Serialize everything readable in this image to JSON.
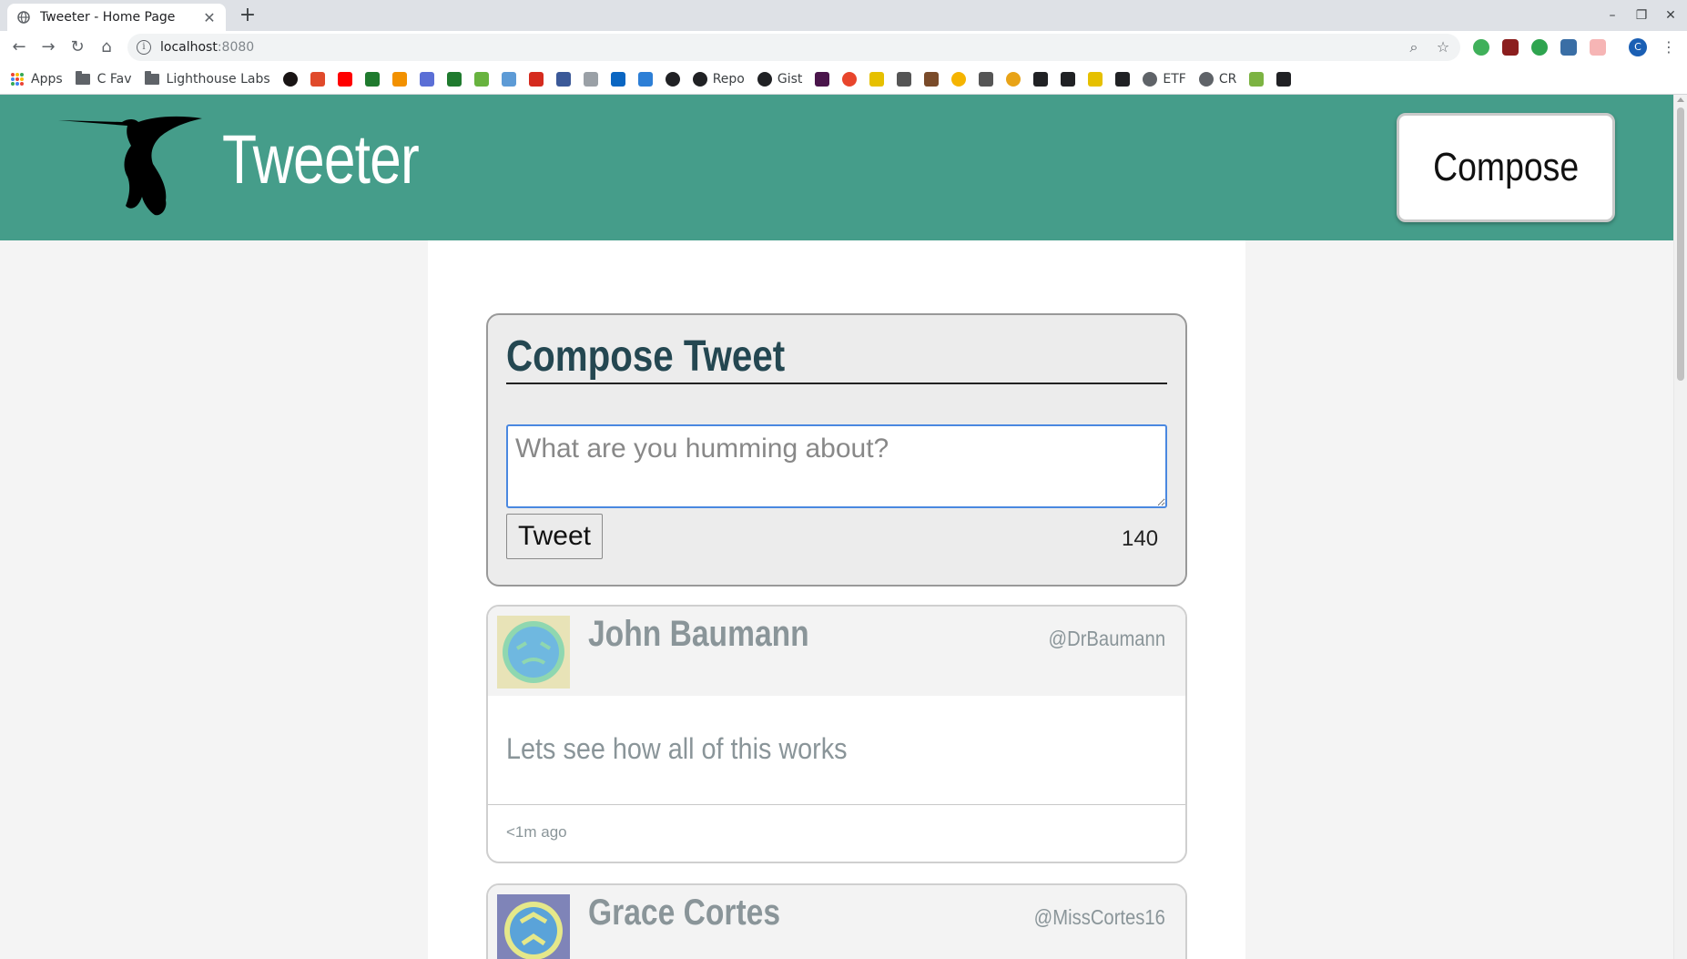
{
  "browser": {
    "tab": {
      "title": "Tweeter - Home Page",
      "close": "✕"
    },
    "new_tab": "+",
    "window_controls": {
      "minimize": "–",
      "restore": "❐",
      "close": "✕"
    },
    "nav": {
      "back": "←",
      "forward": "→",
      "reload": "↻",
      "home": "⌂"
    },
    "url": {
      "host": "localhost",
      "port": ":8080"
    },
    "omnibox_icons": {
      "zoom": "⌕",
      "star": "☆"
    },
    "profile_initial": "C",
    "bookmarks": [
      {
        "label": "Apps",
        "icon": "apps-grid-icon",
        "color": ""
      },
      {
        "label": "C Fav",
        "icon": "folder-icon",
        "color": ""
      },
      {
        "label": "Lighthouse Labs",
        "icon": "folder-icon",
        "color": ""
      },
      {
        "label": "",
        "icon": "spotify-icon",
        "color": "#191414"
      },
      {
        "label": "",
        "icon": "scribd-icon",
        "color": "#e04a2b"
      },
      {
        "label": "",
        "icon": "youtube-icon",
        "color": "#ff0000"
      },
      {
        "label": "",
        "icon": "td-icon",
        "color": "#1f7a2e"
      },
      {
        "label": "",
        "icon": "funnel-icon",
        "color": "#f29100"
      },
      {
        "label": "",
        "icon": "mail-icon",
        "color": "#5b6fd6"
      },
      {
        "label": "",
        "icon": "td-icon",
        "color": "#1f7a2e"
      },
      {
        "label": "",
        "icon": "shield-icon",
        "color": "#68b33f"
      },
      {
        "label": "",
        "icon": "bank-icon",
        "color": "#5d9bd6"
      },
      {
        "label": "",
        "icon": "maple-leaf-icon",
        "color": "#d52b1e"
      },
      {
        "label": "",
        "icon": "facebook-icon",
        "color": "#3b5998"
      },
      {
        "label": "",
        "icon": "globe-grid-icon",
        "color": "#9aa0a6"
      },
      {
        "label": "",
        "icon": "linkedin-icon",
        "color": "#0a66c2"
      },
      {
        "label": "",
        "icon": "cloud-icon",
        "color": "#2d7fd6"
      },
      {
        "label": "",
        "icon": "circle-plus-icon",
        "color": "#202124"
      },
      {
        "label": "Repo",
        "icon": "github-icon",
        "color": "#202124"
      },
      {
        "label": "Gist",
        "icon": "github-icon",
        "color": "#202124"
      },
      {
        "label": "",
        "icon": "slack-icon",
        "color": "#4a154b"
      },
      {
        "label": "",
        "icon": "asterisk-icon",
        "color": "#e8452c"
      },
      {
        "label": "",
        "icon": "ejs-icon",
        "color": "#e6c000"
      },
      {
        "label": "",
        "icon": "cb-icon",
        "color": "#555555"
      },
      {
        "label": "",
        "icon": "flag-icon",
        "color": "#7a4b2a"
      },
      {
        "label": "",
        "icon": "chrome-icon",
        "color": "#f5b400"
      },
      {
        "label": "",
        "icon": "fork-icon",
        "color": "#555555"
      },
      {
        "label": "",
        "icon": "circle-icon",
        "color": "#e8a317"
      },
      {
        "label": "",
        "icon": "square-icon",
        "color": "#202124"
      },
      {
        "label": "",
        "icon": "dots-icon",
        "color": "#202124"
      },
      {
        "label": "",
        "icon": "ejs-icon",
        "color": "#e6c000"
      },
      {
        "label": "",
        "icon": "dots-icon",
        "color": "#202124"
      },
      {
        "label": "ETF",
        "icon": "globe-icon",
        "color": "#5f6368"
      },
      {
        "label": "CR",
        "icon": "globe-icon",
        "color": "#5f6368"
      },
      {
        "label": "",
        "icon": "android-icon",
        "color": "#7cb342"
      },
      {
        "label": "",
        "icon": "square-icon",
        "color": "#202124"
      }
    ]
  },
  "page": {
    "brand": "Tweeter",
    "compose_button": "Compose",
    "compose": {
      "heading": "Compose Tweet",
      "placeholder": "What are you humming about?",
      "value": "",
      "submit": "Tweet",
      "counter": "140"
    },
    "tweets": [
      {
        "name": "John Baumann",
        "handle": "@DrBaumann",
        "text": "Lets see how all of this works",
        "age": "<1m ago",
        "avatar_bg": "#e8e3b7",
        "avatar_fg": "#6fb8e0"
      },
      {
        "name": "Grace Cortes",
        "handle": "@MissCortes16",
        "text": "",
        "age": "",
        "avatar_bg": "#7f84b8",
        "avatar_fg": "#e5e88a"
      }
    ]
  },
  "colors": {
    "navbar": "#459d8a",
    "heading": "#244751",
    "muted": "#8a9599",
    "focus": "#4a88e0"
  }
}
